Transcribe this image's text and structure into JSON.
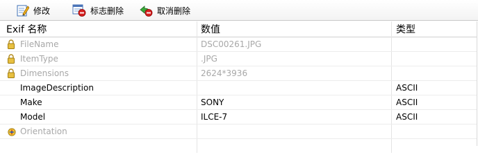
{
  "toolbar": {
    "edit_label": "修改",
    "mark_delete_label": "标志删除",
    "undo_delete_label": "取消删除"
  },
  "table": {
    "headers": {
      "name": "Exif 名称",
      "value": "数值",
      "type": "类型"
    },
    "rows": [
      {
        "name": "FileName",
        "value": "DSC00261.JPG",
        "type": "",
        "locked": true,
        "icon": "lock-icon"
      },
      {
        "name": "ItemType",
        "value": ".JPG",
        "type": "",
        "locked": true,
        "icon": "lock-icon"
      },
      {
        "name": "Dimensions",
        "value": "2624*3936",
        "type": "",
        "locked": true,
        "icon": "lock-icon"
      },
      {
        "name": "ImageDescription",
        "value": "",
        "type": "ASCII",
        "locked": false,
        "icon": ""
      },
      {
        "name": "Make",
        "value": "SONY",
        "type": "ASCII",
        "locked": false,
        "icon": ""
      },
      {
        "name": "Model",
        "value": "ILCE-7",
        "type": "ASCII",
        "locked": false,
        "icon": ""
      },
      {
        "name": "Orientation",
        "value": "",
        "type": "",
        "locked": true,
        "icon": "orientation-icon"
      }
    ]
  },
  "colors": {
    "disabled_text": "#a8a8a8",
    "lock_icon": "#e0b030",
    "delete_badge": "#d62020"
  }
}
